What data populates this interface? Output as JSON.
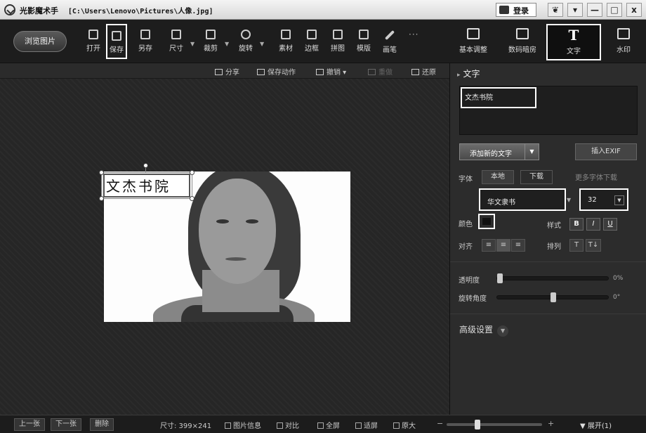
{
  "titlebar": {
    "app_name": "光影魔术手",
    "file_path": "[C:\\Users\\Lenovo\\Pictures\\人像.jpg]",
    "login_label": "登录",
    "window_buttons": [
      "❦",
      "▾",
      "—",
      "□",
      "x"
    ]
  },
  "toolbar": {
    "browse_label": "浏览图片",
    "tools": [
      {
        "label": "打开",
        "icon": "open-icon"
      },
      {
        "label": "保存",
        "icon": "save-icon"
      },
      {
        "label": "另存",
        "icon": "save-as-icon"
      },
      {
        "label": "尺寸",
        "icon": "resize-icon"
      },
      {
        "label": "裁剪",
        "icon": "crop-icon"
      },
      {
        "label": "旋转",
        "icon": "rotate-icon"
      },
      {
        "label": "素材",
        "icon": "material-icon"
      },
      {
        "label": "边框",
        "icon": "frame-icon"
      },
      {
        "label": "拼图",
        "icon": "puzzle-icon"
      },
      {
        "label": "模版",
        "icon": "template-icon"
      },
      {
        "label": "画笔",
        "icon": "brush-icon"
      }
    ],
    "more": "···"
  },
  "right_tabs": [
    {
      "label": "基本调整",
      "icon": "adjust-icon"
    },
    {
      "label": "数码暗房",
      "icon": "darkroom-icon"
    },
    {
      "label": "文字",
      "icon": "text-icon"
    },
    {
      "label": "水印",
      "icon": "watermark-icon"
    }
  ],
  "subbar": {
    "share": "分享",
    "save_action": "保存动作",
    "undo": "撤销",
    "redo": "重做",
    "restore": "还原"
  },
  "canvas": {
    "overlay_text": "文杰书院"
  },
  "text_panel": {
    "heading": "文字",
    "text_value": "文杰书院",
    "add_new_text": "添加新的文字",
    "insert_exif": "插入EXIF",
    "font_label": "字体",
    "local_tab": "本地",
    "download_tab": "下载",
    "more_fonts": "更多字体下载",
    "font_name": "华文隶书",
    "font_size": "32",
    "color_label": "颜色",
    "text_color": "#111111",
    "style_label": "样式",
    "style_buttons": [
      "B",
      "I",
      "U"
    ],
    "align_label": "对齐",
    "align_buttons": [
      "≡",
      "≡",
      "≡"
    ],
    "arrange_label": "排列",
    "arrange_buttons": [
      "T",
      "T↓"
    ],
    "opacity_label": "透明度",
    "opacity_value": "0%",
    "opacity_level": 0,
    "rotation_label": "旋转角度",
    "rotation_value": "0°",
    "advanced_label": "高级设置"
  },
  "bottombar": {
    "prev": "上一张",
    "next": "下一张",
    "delete": "删除",
    "size_label": "尺寸: 399×241",
    "info": "图片信息",
    "compare": "对比",
    "fullscreen": "全屏",
    "fit": "适屏",
    "original": "原大",
    "zoom_minus": "−",
    "zoom_plus": "+",
    "expand": "展开(1)"
  }
}
